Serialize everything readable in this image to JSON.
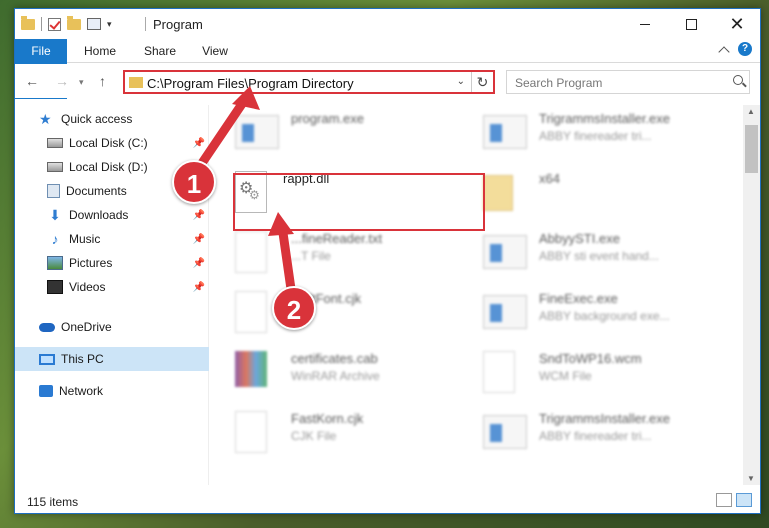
{
  "window": {
    "title": "Program"
  },
  "ribbon": {
    "tabs": [
      {
        "label": "File"
      },
      {
        "label": "Home"
      },
      {
        "label": "Share"
      },
      {
        "label": "View"
      }
    ]
  },
  "address": {
    "path": "C:\\Program Files\\Program Directory"
  },
  "search": {
    "placeholder": "Search Program"
  },
  "sidebar": {
    "items": [
      {
        "label": "Quick access",
        "icon": "quick-access-star-icon",
        "pinned": false
      },
      {
        "label": "Local Disk (C:)",
        "icon": "drive-icon",
        "pinned": true
      },
      {
        "label": "Local Disk (D:)",
        "icon": "drive-icon",
        "pinned": false
      },
      {
        "label": "Documents",
        "icon": "documents-icon",
        "pinned": true
      },
      {
        "label": "Downloads",
        "icon": "downloads-icon",
        "pinned": true
      },
      {
        "label": "Music",
        "icon": "music-icon",
        "pinned": true
      },
      {
        "label": "Pictures",
        "icon": "pictures-icon",
        "pinned": true
      },
      {
        "label": "Videos",
        "icon": "videos-icon",
        "pinned": true
      },
      {
        "label": "OneDrive",
        "icon": "onedrive-icon",
        "pinned": false
      },
      {
        "label": "This PC",
        "icon": "this-pc-icon",
        "pinned": false,
        "selected": true
      },
      {
        "label": "Network",
        "icon": "network-icon",
        "pinned": false
      }
    ]
  },
  "files": [
    {
      "name": "program.exe",
      "type": "",
      "icon": "exe-icon",
      "blurred": true
    },
    {
      "name": "TrigrammsInstaller.exe",
      "type": "ABBY finereader tri...",
      "icon": "exe-icon",
      "blurred": true
    },
    {
      "name": "rappt.dll",
      "type": "",
      "icon": "dll-gear-icon",
      "blurred": false
    },
    {
      "name": "x64",
      "type": "",
      "icon": "folder-icon",
      "blurred": true
    },
    {
      "name": "...fineReader.txt",
      "type": "...T File",
      "icon": "text-file-icon",
      "blurred": true
    },
    {
      "name": "AbbyySTI.exe",
      "type": "ABBY sti event hand...",
      "icon": "exe-icon",
      "blurred": true
    },
    {
      "name": "...ultFont.cjk",
      "type": "...e",
      "icon": "file-icon",
      "blurred": true
    },
    {
      "name": "FineExec.exe",
      "type": "ABBY background exe...",
      "icon": "exe-icon",
      "blurred": true
    },
    {
      "name": "certificates.cab",
      "type": "WinRAR Archive",
      "icon": "winrar-icon",
      "blurred": true
    },
    {
      "name": "SndToWP16.wcm",
      "type": "WCM File",
      "icon": "file-icon",
      "blurred": true
    },
    {
      "name": "FastKorn.cjk",
      "type": "CJK File",
      "icon": "file-icon",
      "blurred": true
    },
    {
      "name": "TrigrammsInstaller.exe",
      "type": "ABBY finereader tri...",
      "icon": "exe-icon",
      "blurred": true
    }
  ],
  "status": {
    "item_count": "115 items"
  },
  "callouts": [
    "1",
    "2"
  ],
  "colors": {
    "accent": "#1979ca",
    "highlight": "#d9333a",
    "selection": "#cce4f7"
  }
}
